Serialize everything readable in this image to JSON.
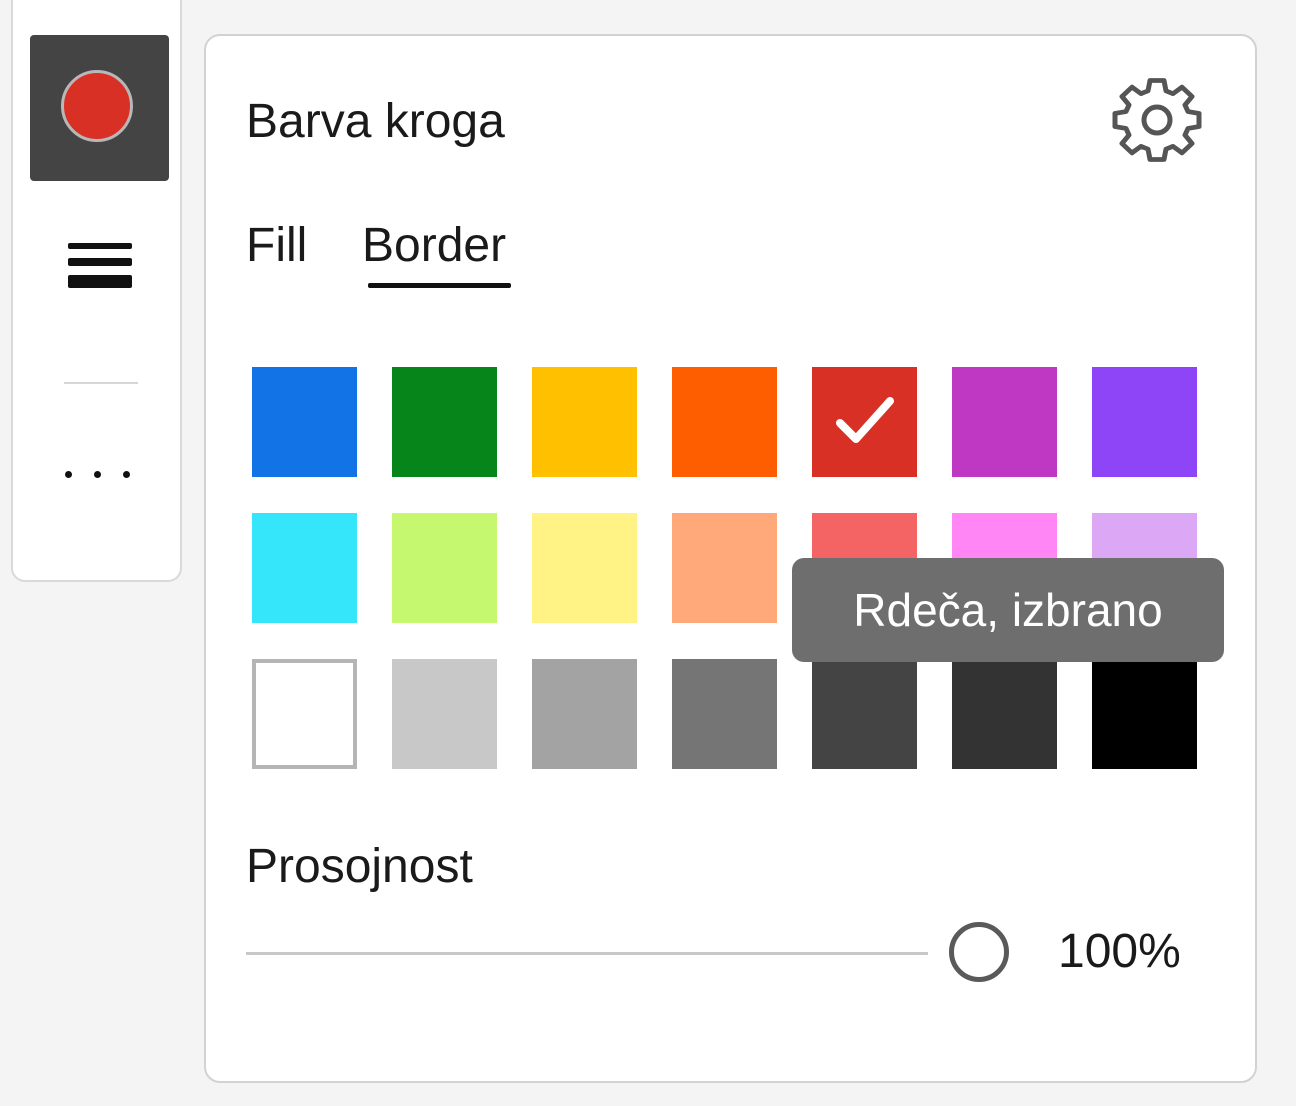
{
  "toolbar": {
    "circle_tool_color": "#d93025",
    "circle_tool_icon": "circle-icon",
    "line_style_icon": "line-weight-icon",
    "more_icon": "more-horizontal-icon"
  },
  "panel": {
    "title": "Barva kroga",
    "settings_icon": "gear-icon",
    "tabs": [
      {
        "label": "Fill",
        "selected": false
      },
      {
        "label": "Border",
        "selected": true
      }
    ],
    "swatches": [
      [
        "#1273e6",
        "#06861a",
        "#ffc000",
        "#ff5e00",
        "#d93025",
        "#bf38c4",
        "#8e45f8"
      ],
      [
        "#35e6fb",
        "#c5f86f",
        "#fff385",
        "#ffa97b",
        "#f56464",
        "#ff86f4",
        "#dca7f5"
      ],
      [
        "#ffffff",
        "#c8c8c8",
        "#a3a3a3",
        "#757575",
        "#444444",
        "#333333",
        "#000000"
      ]
    ],
    "selected_swatch": "#d93025",
    "tooltip": "Rdeča, izbrano",
    "opacity_label": "Prosojnost",
    "opacity_value": "100%",
    "opacity_level": 1.0
  }
}
